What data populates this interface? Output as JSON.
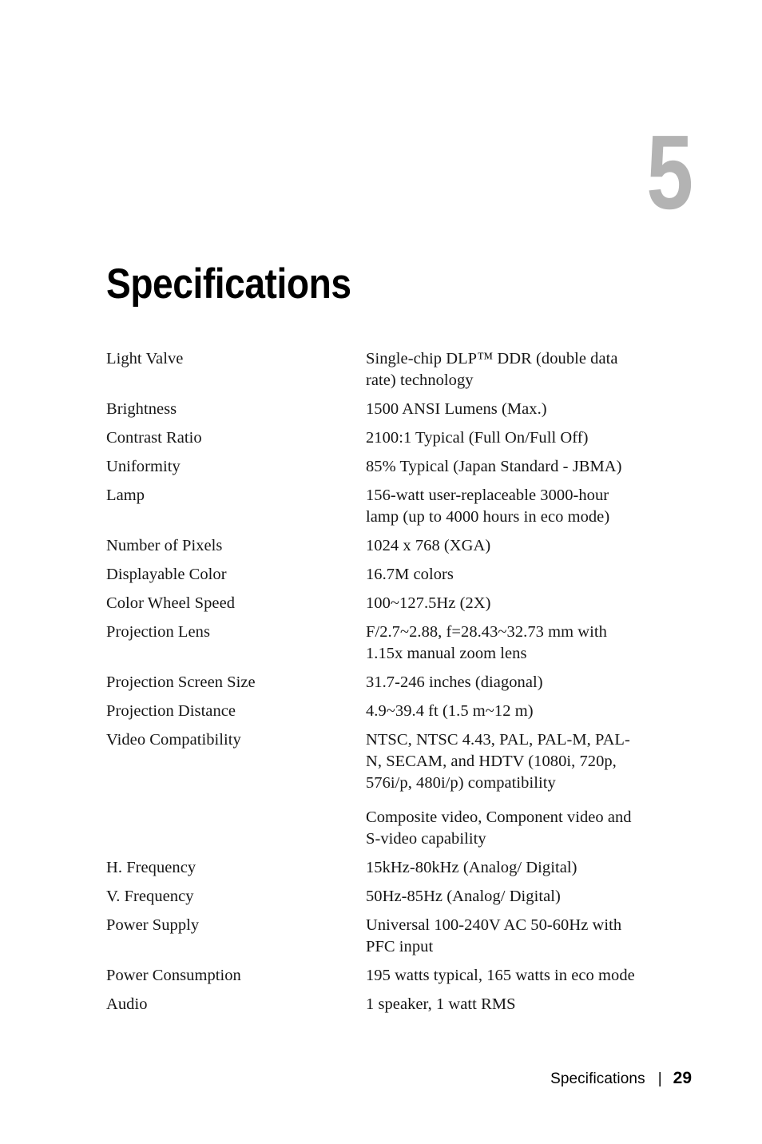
{
  "chapter": {
    "number": "5",
    "title": "Specifications"
  },
  "specs": [
    {
      "label": "Light Valve",
      "values": [
        "Single-chip DLP™ DDR (double data rate) technology"
      ]
    },
    {
      "label": "Brightness",
      "values": [
        "1500 ANSI Lumens (Max.)"
      ]
    },
    {
      "label": "Contrast Ratio",
      "values": [
        "2100:1 Typical (Full On/Full Off)"
      ]
    },
    {
      "label": "Uniformity",
      "values": [
        "85% Typical (Japan Standard - JBMA)"
      ]
    },
    {
      "label": "Lamp",
      "values": [
        "156-watt user-replaceable 3000-hour lamp (up to 4000 hours in eco mode)"
      ]
    },
    {
      "label": "Number of Pixels",
      "values": [
        "1024 x 768 (XGA)"
      ]
    },
    {
      "label": "Displayable Color",
      "values": [
        "16.7M colors"
      ]
    },
    {
      "label": "Color Wheel Speed",
      "values": [
        "100~127.5Hz (2X)"
      ]
    },
    {
      "label": "Projection Lens",
      "values": [
        "F/2.7~2.88, f=28.43~32.73 mm with 1.15x manual zoom lens"
      ]
    },
    {
      "label": "Projection Screen Size",
      "values": [
        "31.7-246 inches (diagonal)"
      ]
    },
    {
      "label": "Projection Distance",
      "values": [
        "4.9~39.4 ft (1.5 m~12 m)"
      ]
    },
    {
      "label": "Video Compatibility",
      "values": [
        "NTSC, NTSC 4.43, PAL, PAL-M, PAL-N, SECAM, and HDTV (1080i, 720p, 576i/p, 480i/p) compatibility",
        "Composite video, Component video and S-video capability"
      ]
    },
    {
      "label": "H. Frequency",
      "values": [
        "15kHz-80kHz (Analog/ Digital)"
      ]
    },
    {
      "label": "V. Frequency",
      "values": [
        "50Hz-85Hz (Analog/ Digital)"
      ]
    },
    {
      "label": "Power Supply",
      "values": [
        "Universal 100-240V AC 50-60Hz with PFC input"
      ]
    },
    {
      "label": "Power Consumption",
      "values": [
        "195 watts typical, 165 watts in eco mode"
      ]
    },
    {
      "label": "Audio",
      "values": [
        "1 speaker, 1 watt RMS"
      ]
    }
  ],
  "footer": {
    "section_title": "Specifications",
    "divider": "|",
    "page_number": "29"
  },
  "colors": {
    "chapter_number": "#b3b3b3",
    "text": "#161616",
    "background": "#ffffff"
  }
}
